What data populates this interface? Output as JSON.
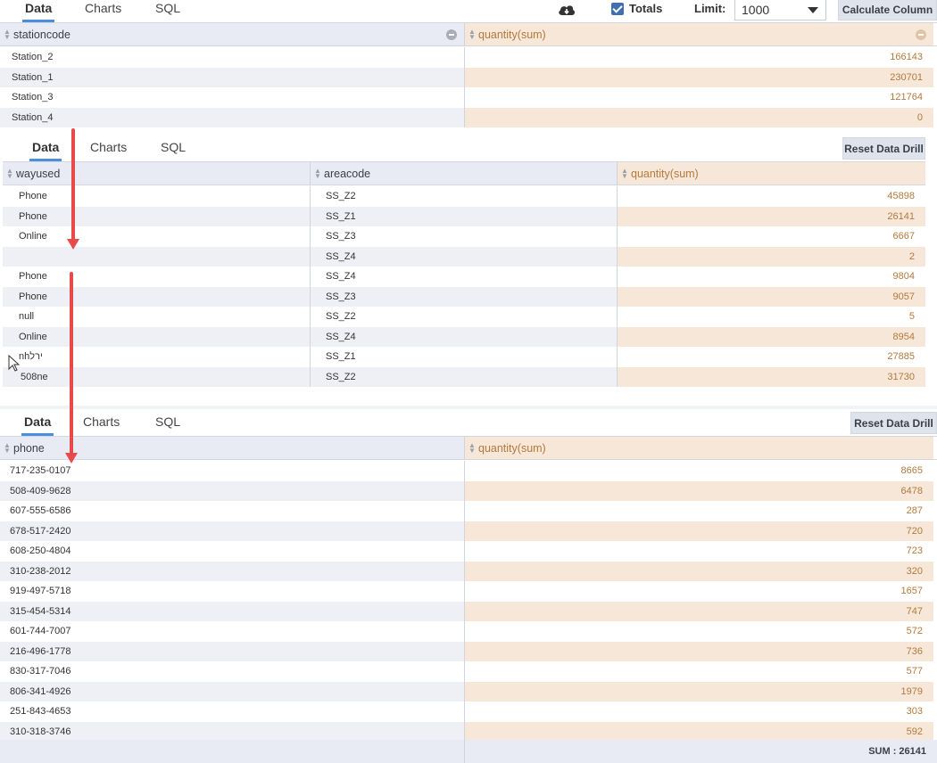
{
  "panel1": {
    "tabs": [
      "Data",
      "Charts",
      "SQL"
    ],
    "totals_label": "Totals",
    "limit_label": "Limit:",
    "limit_value": "1000",
    "calc_button": "Calculate Column",
    "headers": [
      "stationcode",
      "quantity(sum)"
    ],
    "rows": [
      [
        "Station_2",
        "166143"
      ],
      [
        "Station_1",
        "230701"
      ],
      [
        "Station_3",
        "121764"
      ],
      [
        "Station_4",
        "0"
      ]
    ]
  },
  "panel2": {
    "tabs": [
      "Data",
      "Charts",
      "SQL"
    ],
    "reset_button": "Reset Data Drill",
    "headers": [
      "wayused",
      "areacode",
      "quantity(sum)"
    ],
    "rows": [
      [
        "Phone",
        "SS_Z2",
        "45898"
      ],
      [
        "Phone",
        "SS_Z1",
        "26141"
      ],
      [
        "Online",
        "SS_Z3",
        "6667"
      ],
      [
        "",
        "SS_Z4",
        "2"
      ],
      [
        "Phone",
        "SS_Z4",
        "9804"
      ],
      [
        "Phone",
        "SS_Z3",
        "9057"
      ],
      [
        "null",
        "SS_Z2",
        "5"
      ],
      [
        "Online",
        "SS_Z4",
        "8954"
      ],
      [
        "nhירל",
        "SS_Z1",
        "27885"
      ],
      [
        "508ne",
        "SS_Z2",
        "31730"
      ]
    ]
  },
  "panel3": {
    "tabs": [
      "Data",
      "Charts",
      "SQL"
    ],
    "reset_button": "Reset Data Drill",
    "headers": [
      "phone",
      "quantity(sum)"
    ],
    "rows": [
      [
        "717-235-0107",
        "8665"
      ],
      [
        "508-409-9628",
        "6478"
      ],
      [
        "607-555-6586",
        "287"
      ],
      [
        "678-517-2420",
        "720"
      ],
      [
        "608-250-4804",
        "723"
      ],
      [
        "310-238-2012",
        "320"
      ],
      [
        "919-497-5718",
        "1657"
      ],
      [
        "315-454-5314",
        "747"
      ],
      [
        "601-744-7007",
        "572"
      ],
      [
        "216-496-1778",
        "736"
      ],
      [
        "830-317-7046",
        "577"
      ],
      [
        "806-341-4926",
        "1979"
      ],
      [
        "251-843-4653",
        "303"
      ],
      [
        "310-318-3746",
        "592"
      ]
    ],
    "footer_sum": "SUM : 26141"
  },
  "colors": {
    "accent": "#4a90d9",
    "measure_text": "#b27a3e",
    "measure_bg": "#f6e7d8",
    "header_bg": "#e8ebf3",
    "arrow": "#e84a4a"
  }
}
